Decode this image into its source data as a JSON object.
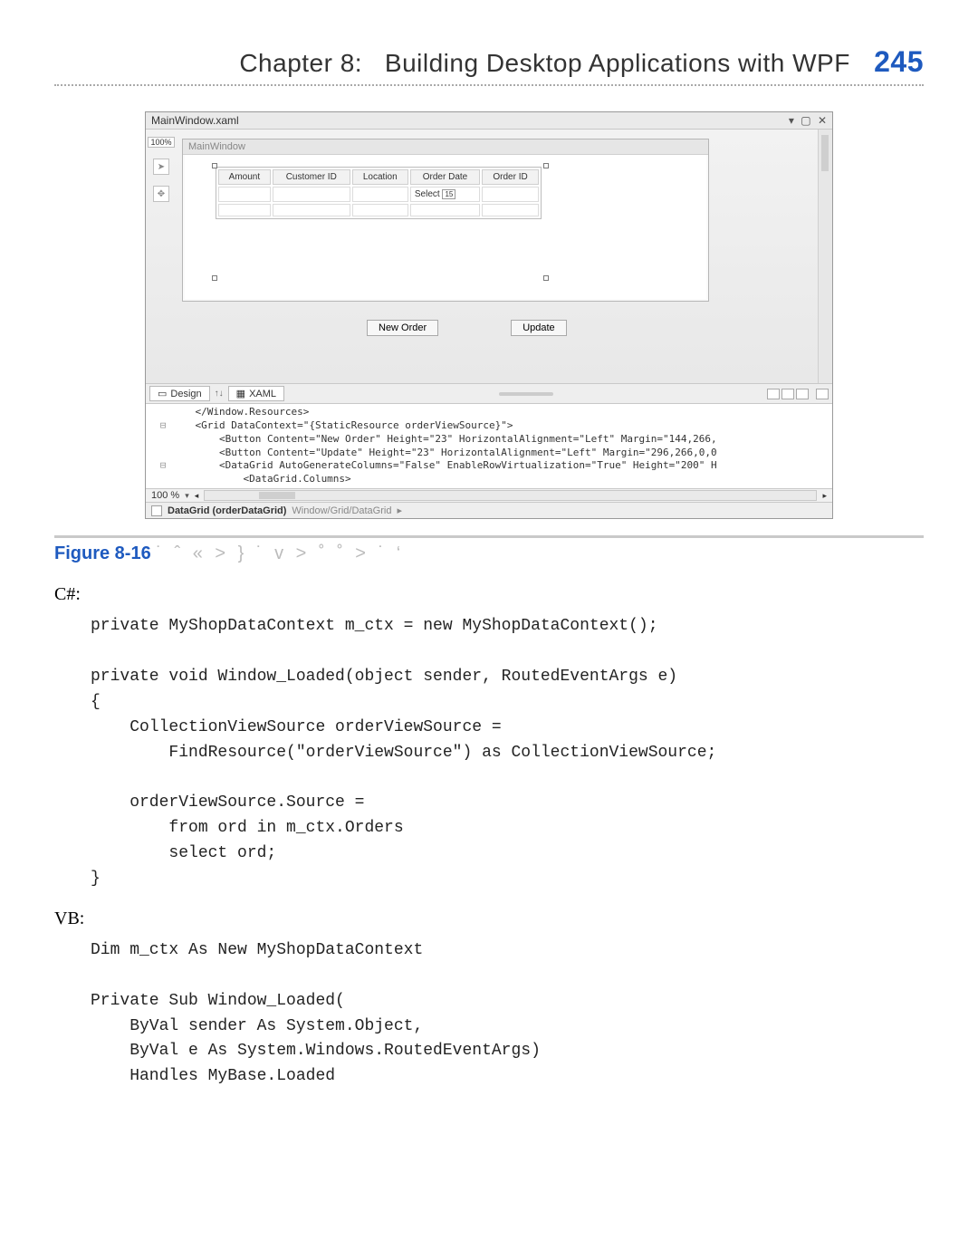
{
  "header": {
    "chapter_label": "Chapter 8:",
    "chapter_title": "Building Desktop Applications with WPF",
    "page_number": "245"
  },
  "ide": {
    "file_tab": "MainWindow.xaml",
    "zoom_badge": "100%",
    "child_window_title": "MainWindow",
    "grid_headers": [
      "Amount",
      "Customer ID",
      "Location",
      "Order Date",
      "Order ID"
    ],
    "grid_cell_select": "Select",
    "buttons": {
      "new_order": "New Order",
      "update": "Update"
    },
    "tabs": {
      "design": "Design",
      "xaml": "XAML"
    },
    "xaml_lines": [
      "    </Window.Resources>",
      "    <Grid DataContext=\"{StaticResource orderViewSource}\">",
      "        <Button Content=\"New Order\" Height=\"23\" HorizontalAlignment=\"Left\" Margin=\"144,266,",
      "        <Button Content=\"Update\" Height=\"23\" HorizontalAlignment=\"Left\" Margin=\"296,266,0,0",
      "        <DataGrid AutoGenerateColumns=\"False\" EnableRowVirtualization=\"True\" Height=\"200\" H",
      "            <DataGrid.Columns>"
    ],
    "status_percent": "100 %",
    "breadcrumb": {
      "bold": "DataGrid (orderDataGrid)",
      "rest": "Window/Grid/DataGrid"
    }
  },
  "figure": {
    "label": "Figure 8-16",
    "rest": "˙    ˆ «  >     } ˙   v    >      ˚   ˚ > ˙     ‘"
  },
  "code": {
    "csharp_label": "C#:",
    "csharp": "private MyShopDataContext m_ctx = new MyShopDataContext();\n\nprivate void Window_Loaded(object sender, RoutedEventArgs e)\n{\n    CollectionViewSource orderViewSource =\n        FindResource(\"orderViewSource\") as CollectionViewSource;\n\n    orderViewSource.Source =\n        from ord in m_ctx.Orders\n        select ord;\n}",
    "vb_label": "VB:",
    "vb": "Dim m_ctx As New MyShopDataContext\n\nPrivate Sub Window_Loaded(\n    ByVal sender As System.Object,\n    ByVal e As System.Windows.RoutedEventArgs)\n    Handles MyBase.Loaded"
  }
}
